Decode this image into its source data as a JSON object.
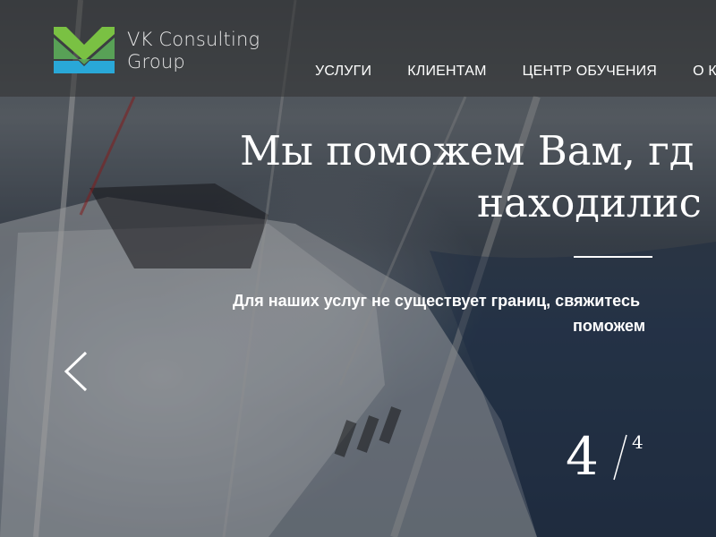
{
  "brand": {
    "name_line1": "VK Consulting",
    "name_line2": "Group",
    "colors": {
      "green": "#7ac143",
      "blue": "#29a8d8"
    }
  },
  "nav": {
    "items": [
      "УСЛУГИ",
      "КЛИЕНТАМ",
      "ЦЕНТР ОБУЧЕНИЯ",
      "О К"
    ]
  },
  "hero": {
    "headline_line1": "Мы поможем Вам, гд",
    "headline_line2": "находилис",
    "subtitle_line1": "Для наших услуг не существует границ, свяжитесь",
    "subtitle_line2": "поможем",
    "prev_icon": "chevron-left-icon"
  },
  "slider": {
    "current": "4",
    "total": "4"
  }
}
